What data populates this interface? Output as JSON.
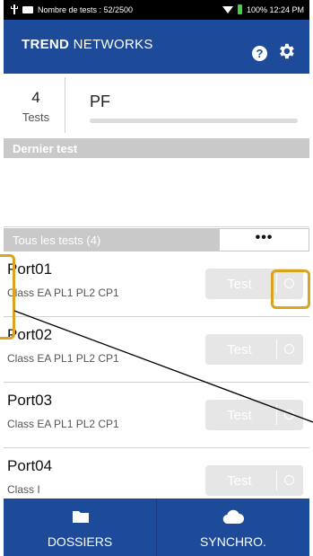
{
  "status_bar": {
    "test_count_text": "Nombre de tests : 52/2500",
    "battery_time_text": "100% 12:24 PM"
  },
  "header": {
    "brand_bold": "TREND",
    "brand_regular": " NETWORKS",
    "help_icon": "?"
  },
  "summary": {
    "count": "4",
    "count_label": "Tests",
    "project": "PF"
  },
  "last_test": {
    "title": "Dernier test"
  },
  "all_tests": {
    "label": "Tous les tests (4)",
    "more_label": "•••"
  },
  "ports": [
    {
      "name": "Port01",
      "class": "Class EA PL1 PL2 CP1",
      "button": "Test"
    },
    {
      "name": "Port02",
      "class": "Class EA PL1 PL2 CP1",
      "button": "Test"
    },
    {
      "name": "Port03",
      "class": "Class EA PL1 PL2 CP1",
      "button": "Test"
    },
    {
      "name": "Port04",
      "class": "Class I",
      "button": "Test"
    }
  ],
  "bottom_nav": {
    "folders_label": "DOSSIERS",
    "sync_label": "SYNCHRO."
  },
  "colors": {
    "brand_blue": "#1e4a9a",
    "highlight": "#d9a520",
    "section_gray": "#c9c9c9"
  }
}
